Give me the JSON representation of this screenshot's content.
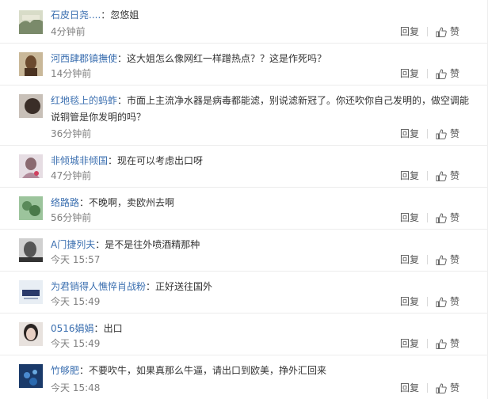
{
  "comments": [
    {
      "nick": "石皮日尧....",
      "text": "忽悠姐",
      "time": "4分钟前",
      "reply": "回复",
      "like": "赞",
      "avatar_color": "#7a8a6a"
    },
    {
      "nick": "河西肆郡镇撫使",
      "text": "这大姐怎么像网红一样蹭热点？？这是作死吗？",
      "time": "14分钟前",
      "reply": "回复",
      "like": "赞",
      "avatar_color": "#6b4a2e"
    },
    {
      "nick": "红地毯上的蚂蚱",
      "text": "市面上主流净水器是病毒都能滤，别说滤新冠了。你还吹你自己发明的，做空调能说铜管是你发明的吗？",
      "time": "36分钟前",
      "reply": "回复",
      "like": "赞",
      "avatar_color": "#3a2e28"
    },
    {
      "nick": "非倾城非倾国",
      "text": "现在可以考虑出口呀",
      "time": "47分钟前",
      "reply": "回复",
      "like": "赞",
      "avatar_color": "#b08a9a"
    },
    {
      "nick": "络路路",
      "text": "不晚啊，卖欧州去啊",
      "time": "56分钟前",
      "reply": "回复",
      "like": "赞",
      "avatar_color": "#5a8a5a"
    },
    {
      "nick": "A门捷列夫",
      "text": "是不是往外喷酒精那种",
      "time": "今天 15:57",
      "reply": "回复",
      "like": "赞",
      "avatar_color": "#555555"
    },
    {
      "nick": "为君销得人憔悴肖战粉",
      "text": "正好送往国外",
      "time": "今天 15:49",
      "reply": "回复",
      "like": "赞",
      "avatar_color": "#e8eef4"
    },
    {
      "nick": "0516娟娟",
      "text": "出口",
      "time": "今天 15:49",
      "reply": "回复",
      "like": "赞",
      "avatar_color": "#c8b8b0"
    },
    {
      "nick": "竹够肥",
      "text": "不要吹牛，如果真那么牛逼，请出口到欧美，挣外汇回来",
      "time": "今天 15:48",
      "reply": "回复",
      "like": "赞",
      "avatar_color": "#2a5a9a"
    }
  ]
}
